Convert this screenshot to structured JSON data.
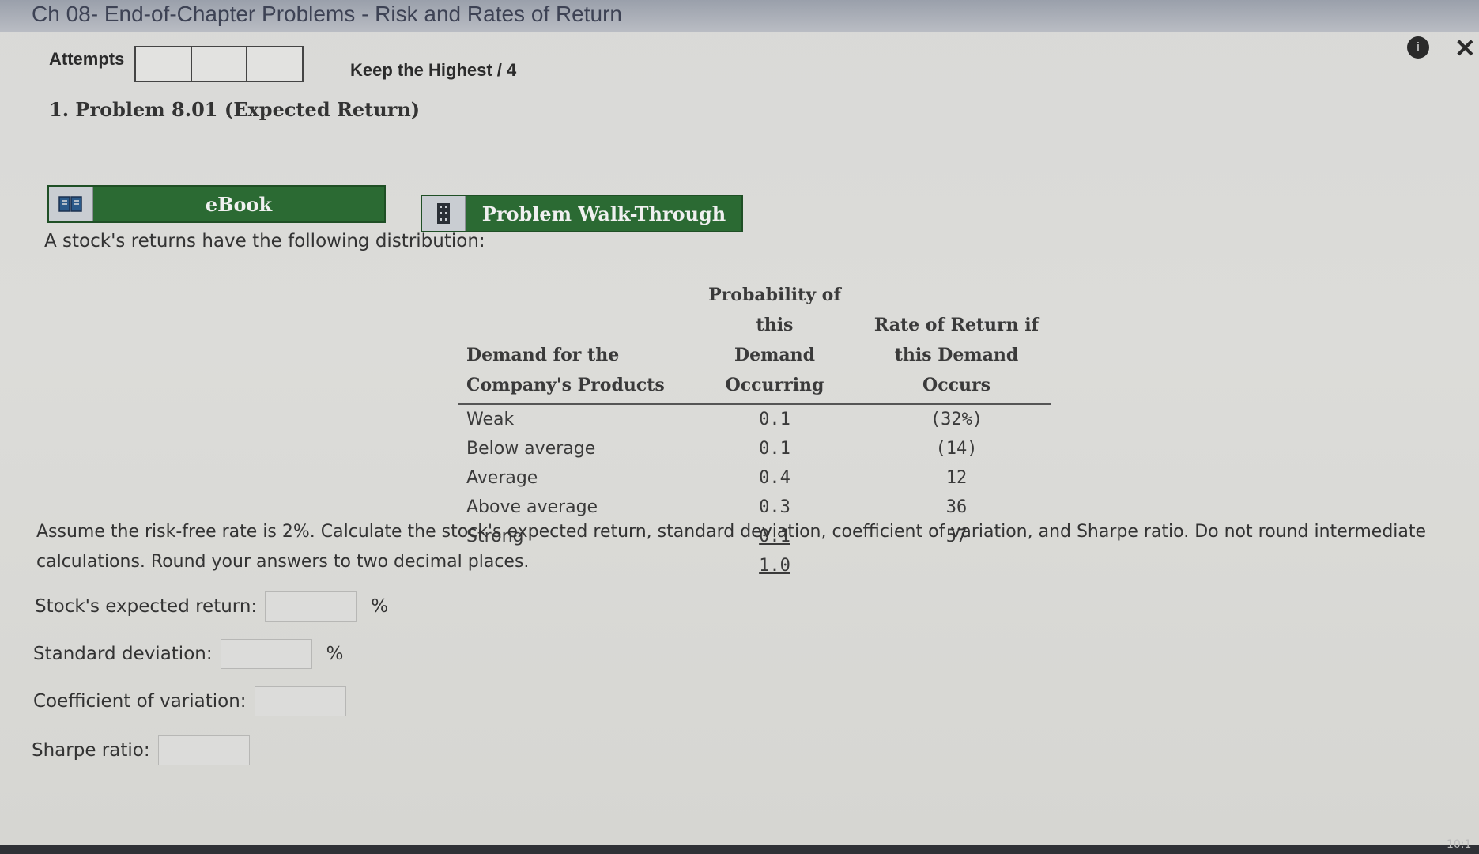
{
  "window": {
    "title": "Ch 08- End-of-Chapter Problems - Risk and Rates of Return"
  },
  "header": {
    "attempts_label": "Attempts",
    "keep_label": "Keep the Highest / 4"
  },
  "problem": {
    "title": "1.  Problem 8.01 (Expected Return)"
  },
  "buttons": {
    "ebook_label": "eBook",
    "walkthrough_label": "Problem Walk-Through"
  },
  "intro_text": "A stock's returns have the following distribution:",
  "table": {
    "headers": [
      [
        "Demand for the",
        "Company's Products"
      ],
      [
        "Probability of this",
        "Demand Occurring"
      ],
      [
        "Rate of Return if",
        "this Demand Occurs"
      ]
    ],
    "rows": [
      {
        "demand": "Weak",
        "probability": "0.1",
        "rate": "(32%)"
      },
      {
        "demand": "Below average",
        "probability": "0.1",
        "rate": "(14)"
      },
      {
        "demand": "Average",
        "probability": "0.4",
        "rate": "12"
      },
      {
        "demand": "Above average",
        "probability": "0.3",
        "rate": "36"
      },
      {
        "demand": "Strong",
        "probability": "0.1",
        "rate": "57"
      }
    ],
    "total": "1.0"
  },
  "instructions": "Assume the risk-free rate is 2%. Calculate the stock's expected return, standard deviation, coefficient of variation, and Sharpe ratio. Do not round intermediate calculations. Round your answers to two decimal places.",
  "fields": {
    "expected_return_label": "Stock's expected return:",
    "std_dev_label": "Standard deviation:",
    "cv_label": "Coefficient of variation:",
    "sharpe_label": "Sharpe ratio:",
    "percent": "%"
  },
  "icons": {
    "info": "info-icon",
    "close": "close-icon",
    "ebook": "book-icon",
    "walkthrough": "film-icon"
  },
  "colors": {
    "button_green": "#2b6a33",
    "background": "#d9d9d7"
  },
  "status": {
    "clock": "10:1"
  }
}
